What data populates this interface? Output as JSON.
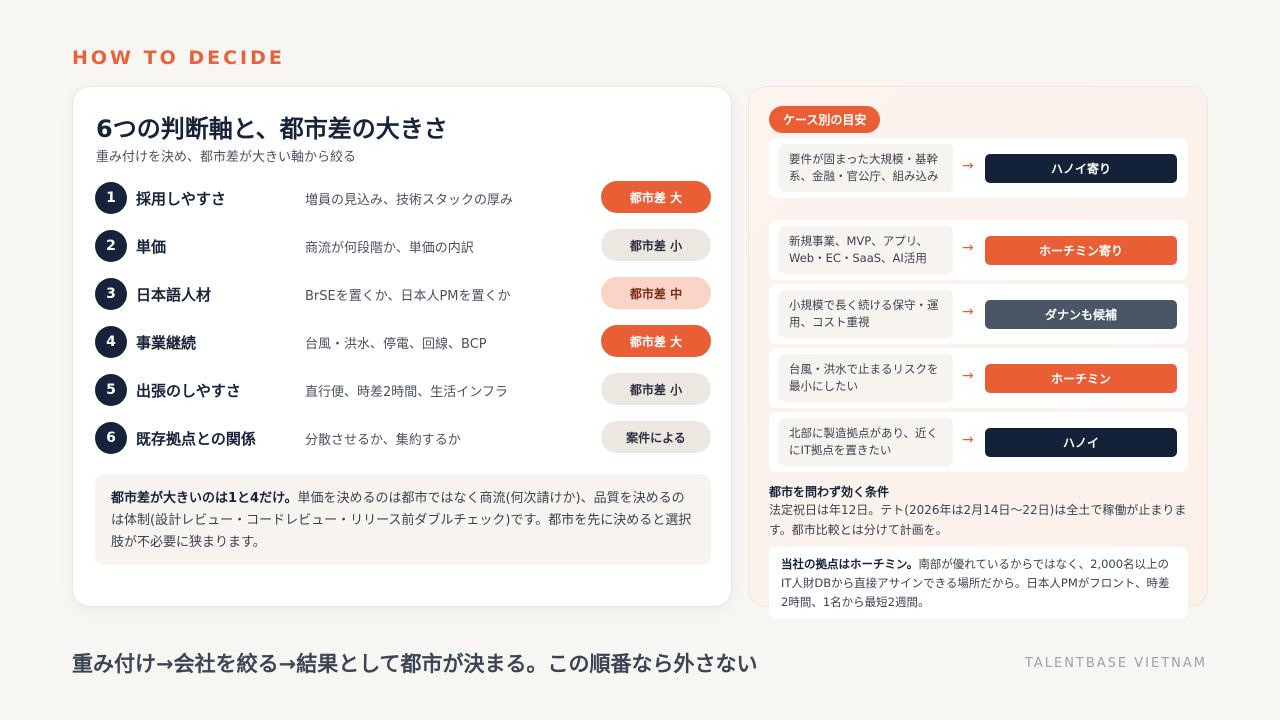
{
  "eyebrow": "HOW TO DECIDE",
  "left": {
    "title": "6つの判断軸と、都市差の大きさ",
    "subtitle": "重み付けを決め、都市差が大きい軸から絞る",
    "axes": [
      {
        "num": "1",
        "name": "採用しやすさ",
        "desc": "増員の見込み、技術スタックの厚み",
        "impact": "都市差 大"
      },
      {
        "num": "2",
        "name": "単価",
        "desc": "商流が何段階か、単価の内訳",
        "impact": "都市差 小"
      },
      {
        "num": "3",
        "name": "日本語人材",
        "desc": "BrSEを置くか、日本人PMを置くか",
        "impact": "都市差 中"
      },
      {
        "num": "4",
        "name": "事業継続",
        "desc": "台風・洪水、停電、回線、BCP",
        "impact": "都市差 大"
      },
      {
        "num": "5",
        "name": "出張のしやすさ",
        "desc": "直行便、時差2時間、生活インフラ",
        "impact": "都市差 小"
      },
      {
        "num": "6",
        "name": "既存拠点との関係",
        "desc": "分散させるか、集約するか",
        "impact": "案件による"
      }
    ],
    "note": {
      "bold": "都市差が大きいのは1と4だけ。",
      "text": "単価を決めるのは都市ではなく商流(何次請けか)、品質を決めるのは体制(設計レビュー・コードレビュー・リリース前ダブルチェック)です。都市を先に決めると選択肢が不必要に狭まります。"
    }
  },
  "right": {
    "tag": "ケース別の目安",
    "cases": [
      {
        "condition": "要件が固まった大規模・基幹系、金融・官公庁、組み込み",
        "arrow": "→",
        "result": "ハノイ寄り"
      },
      {
        "condition": "新規事業、MVP、アプリ、Web・EC・SaaS、AI活用",
        "arrow": "→",
        "result": "ホーチミン寄り"
      },
      {
        "condition": "小規模で長く続ける保守・運用、コスト重視",
        "arrow": "→",
        "result": "ダナンも候補"
      },
      {
        "condition": "台風・洪水で止まるリスクを最小にしたい",
        "arrow": "→",
        "result": "ホーチミン"
      },
      {
        "condition": "北部に製造拠点があり、近くにIT拠点を置きたい",
        "arrow": "→",
        "result": "ハノイ"
      }
    ],
    "universal_title": "都市を問わず効く条件",
    "universal_text": "法定祝日は年12日。テト(2026年は2月14日〜22日)は全土で稼働が止まります。都市比較とは分けて計画を。",
    "base": {
      "bold": "当社の拠点はホーチミン。",
      "text": "南部が優れているからではなく、2,000名以上のIT人財DBから直接アサインできる場所だから。日本人PMがフロント、時差2時間、1名から最短2週間。"
    }
  },
  "footer": {
    "message": "重み付け→会社を絞る→結果として都市が決まる。この順番なら外さない",
    "brand": "TALENTBASE VIETNAM"
  },
  "colors": {
    "accent": "#ea5e36",
    "navy": "#132238",
    "slate": "#4a5566"
  }
}
